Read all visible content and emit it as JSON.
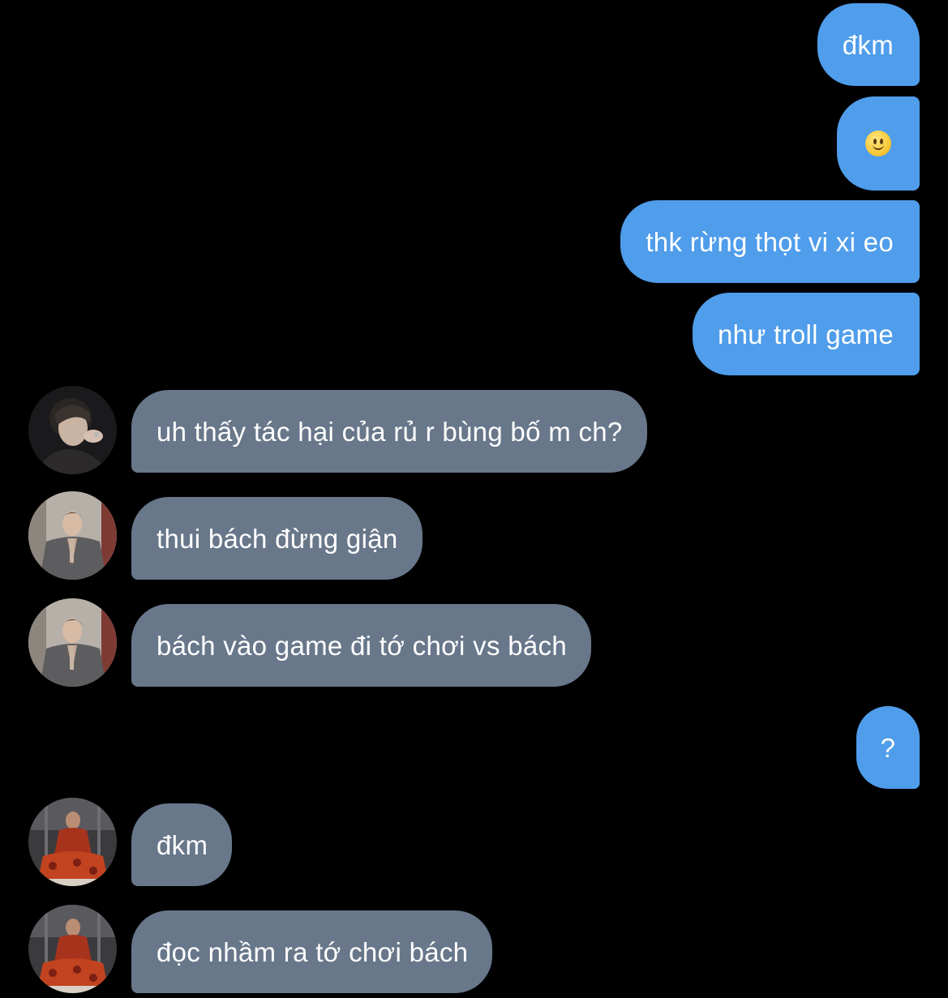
{
  "chat": {
    "messages": [
      {
        "side": "sent",
        "text": "đkm"
      },
      {
        "side": "sent",
        "emoji": "slightly-smiling-face",
        "text": "🙂"
      },
      {
        "side": "sent",
        "text": "thk rừng thọt vi xi eo"
      },
      {
        "side": "sent",
        "text": "như troll game"
      },
      {
        "side": "received",
        "avatar": "contact-avatar-dark-portrait",
        "text": "uh thấy tác hại của rủ r bùng bố m ch?"
      },
      {
        "side": "received",
        "avatar": "contact-avatar-grey-suit",
        "text": "thui bách đừng giận"
      },
      {
        "side": "received",
        "avatar": "contact-avatar-grey-suit",
        "text": "bách vào game đi tớ chơi vs bách"
      },
      {
        "side": "sent",
        "text": "?"
      },
      {
        "side": "received",
        "avatar": "contact-avatar-red-outfit",
        "text": "đkm"
      },
      {
        "side": "received",
        "avatar": "contact-avatar-red-outfit",
        "text": "đọc nhầm ra tớ chơi bách"
      }
    ]
  },
  "colors": {
    "background": "#000000",
    "sent_bubble": "#4f9deb",
    "received_bubble": "#68778a",
    "text": "#ffffff"
  }
}
